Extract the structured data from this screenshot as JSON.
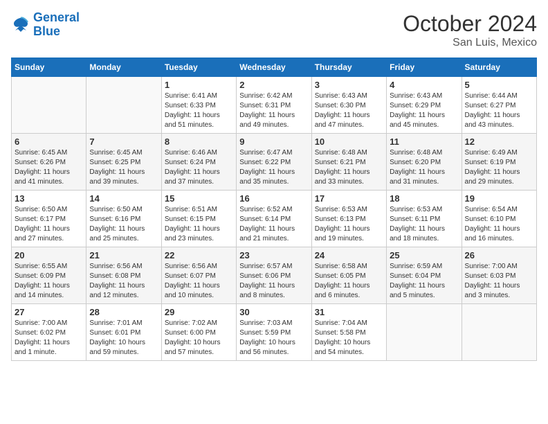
{
  "logo": {
    "line1": "General",
    "line2": "Blue"
  },
  "title": "October 2024",
  "location": "San Luis, Mexico",
  "days_of_week": [
    "Sunday",
    "Monday",
    "Tuesday",
    "Wednesday",
    "Thursday",
    "Friday",
    "Saturday"
  ],
  "weeks": [
    [
      {
        "day": "",
        "info": ""
      },
      {
        "day": "",
        "info": ""
      },
      {
        "day": "1",
        "info": "Sunrise: 6:41 AM\nSunset: 6:33 PM\nDaylight: 11 hours\nand 51 minutes."
      },
      {
        "day": "2",
        "info": "Sunrise: 6:42 AM\nSunset: 6:31 PM\nDaylight: 11 hours\nand 49 minutes."
      },
      {
        "day": "3",
        "info": "Sunrise: 6:43 AM\nSunset: 6:30 PM\nDaylight: 11 hours\nand 47 minutes."
      },
      {
        "day": "4",
        "info": "Sunrise: 6:43 AM\nSunset: 6:29 PM\nDaylight: 11 hours\nand 45 minutes."
      },
      {
        "day": "5",
        "info": "Sunrise: 6:44 AM\nSunset: 6:27 PM\nDaylight: 11 hours\nand 43 minutes."
      }
    ],
    [
      {
        "day": "6",
        "info": "Sunrise: 6:45 AM\nSunset: 6:26 PM\nDaylight: 11 hours\nand 41 minutes."
      },
      {
        "day": "7",
        "info": "Sunrise: 6:45 AM\nSunset: 6:25 PM\nDaylight: 11 hours\nand 39 minutes."
      },
      {
        "day": "8",
        "info": "Sunrise: 6:46 AM\nSunset: 6:24 PM\nDaylight: 11 hours\nand 37 minutes."
      },
      {
        "day": "9",
        "info": "Sunrise: 6:47 AM\nSunset: 6:22 PM\nDaylight: 11 hours\nand 35 minutes."
      },
      {
        "day": "10",
        "info": "Sunrise: 6:48 AM\nSunset: 6:21 PM\nDaylight: 11 hours\nand 33 minutes."
      },
      {
        "day": "11",
        "info": "Sunrise: 6:48 AM\nSunset: 6:20 PM\nDaylight: 11 hours\nand 31 minutes."
      },
      {
        "day": "12",
        "info": "Sunrise: 6:49 AM\nSunset: 6:19 PM\nDaylight: 11 hours\nand 29 minutes."
      }
    ],
    [
      {
        "day": "13",
        "info": "Sunrise: 6:50 AM\nSunset: 6:17 PM\nDaylight: 11 hours\nand 27 minutes."
      },
      {
        "day": "14",
        "info": "Sunrise: 6:50 AM\nSunset: 6:16 PM\nDaylight: 11 hours\nand 25 minutes."
      },
      {
        "day": "15",
        "info": "Sunrise: 6:51 AM\nSunset: 6:15 PM\nDaylight: 11 hours\nand 23 minutes."
      },
      {
        "day": "16",
        "info": "Sunrise: 6:52 AM\nSunset: 6:14 PM\nDaylight: 11 hours\nand 21 minutes."
      },
      {
        "day": "17",
        "info": "Sunrise: 6:53 AM\nSunset: 6:13 PM\nDaylight: 11 hours\nand 19 minutes."
      },
      {
        "day": "18",
        "info": "Sunrise: 6:53 AM\nSunset: 6:11 PM\nDaylight: 11 hours\nand 18 minutes."
      },
      {
        "day": "19",
        "info": "Sunrise: 6:54 AM\nSunset: 6:10 PM\nDaylight: 11 hours\nand 16 minutes."
      }
    ],
    [
      {
        "day": "20",
        "info": "Sunrise: 6:55 AM\nSunset: 6:09 PM\nDaylight: 11 hours\nand 14 minutes."
      },
      {
        "day": "21",
        "info": "Sunrise: 6:56 AM\nSunset: 6:08 PM\nDaylight: 11 hours\nand 12 minutes."
      },
      {
        "day": "22",
        "info": "Sunrise: 6:56 AM\nSunset: 6:07 PM\nDaylight: 11 hours\nand 10 minutes."
      },
      {
        "day": "23",
        "info": "Sunrise: 6:57 AM\nSunset: 6:06 PM\nDaylight: 11 hours\nand 8 minutes."
      },
      {
        "day": "24",
        "info": "Sunrise: 6:58 AM\nSunset: 6:05 PM\nDaylight: 11 hours\nand 6 minutes."
      },
      {
        "day": "25",
        "info": "Sunrise: 6:59 AM\nSunset: 6:04 PM\nDaylight: 11 hours\nand 5 minutes."
      },
      {
        "day": "26",
        "info": "Sunrise: 7:00 AM\nSunset: 6:03 PM\nDaylight: 11 hours\nand 3 minutes."
      }
    ],
    [
      {
        "day": "27",
        "info": "Sunrise: 7:00 AM\nSunset: 6:02 PM\nDaylight: 11 hours\nand 1 minute."
      },
      {
        "day": "28",
        "info": "Sunrise: 7:01 AM\nSunset: 6:01 PM\nDaylight: 10 hours\nand 59 minutes."
      },
      {
        "day": "29",
        "info": "Sunrise: 7:02 AM\nSunset: 6:00 PM\nDaylight: 10 hours\nand 57 minutes."
      },
      {
        "day": "30",
        "info": "Sunrise: 7:03 AM\nSunset: 5:59 PM\nDaylight: 10 hours\nand 56 minutes."
      },
      {
        "day": "31",
        "info": "Sunrise: 7:04 AM\nSunset: 5:58 PM\nDaylight: 10 hours\nand 54 minutes."
      },
      {
        "day": "",
        "info": ""
      },
      {
        "day": "",
        "info": ""
      }
    ]
  ]
}
